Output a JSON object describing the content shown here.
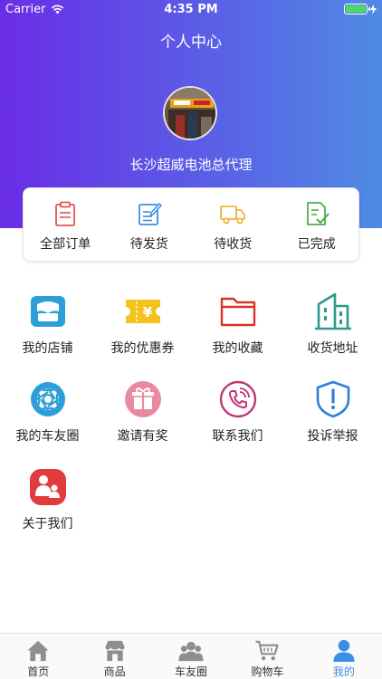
{
  "status_bar": {
    "carrier": "Carrier",
    "time": "4:35 PM"
  },
  "page": {
    "title": "个人中心"
  },
  "profile": {
    "username": "长沙超威电池总代理"
  },
  "orders": [
    {
      "label": "全部订单",
      "icon": "clipboard-icon",
      "color": "#e05555"
    },
    {
      "label": "待发货",
      "icon": "edit-note-icon",
      "color": "#3a8ee6"
    },
    {
      "label": "待收货",
      "icon": "truck-icon",
      "color": "#f0b23a"
    },
    {
      "label": "已完成",
      "icon": "checked-doc-icon",
      "color": "#4cae4c"
    }
  ],
  "menu": [
    {
      "label": "我的店铺",
      "icon": "store-icon",
      "color": "#2d9ed8"
    },
    {
      "label": "我的优惠券",
      "icon": "coupon-icon",
      "color": "#f3c21b"
    },
    {
      "label": "我的收藏",
      "icon": "folder-icon",
      "color": "#d9332b"
    },
    {
      "label": "收货地址",
      "icon": "building-icon",
      "color": "#2c9a8e"
    },
    {
      "label": "我的车友圈",
      "icon": "aperture-icon",
      "color": "#2d9ed8"
    },
    {
      "label": "邀请有奖",
      "icon": "gift-icon",
      "color": "#e98aa0"
    },
    {
      "label": "联系我们",
      "icon": "phone-icon",
      "color": "#c0357a"
    },
    {
      "label": "投诉举报",
      "icon": "shield-alert-icon",
      "color": "#2d7fd8"
    },
    {
      "label": "关于我们",
      "icon": "people-icon",
      "color": "#e23b3b"
    }
  ],
  "tabbar": {
    "active": "我的",
    "tabs": [
      {
        "label": "首页",
        "icon": "home-icon"
      },
      {
        "label": "商品",
        "icon": "shop-icon"
      },
      {
        "label": "车友圈",
        "icon": "group-icon"
      },
      {
        "label": "购物车",
        "icon": "cart-icon"
      },
      {
        "label": "我的",
        "icon": "user-icon"
      }
    ]
  },
  "colors": {
    "accent": "#3a8ee6",
    "gradient_start": "#6a2de6",
    "gradient_end": "#4f8be4"
  }
}
